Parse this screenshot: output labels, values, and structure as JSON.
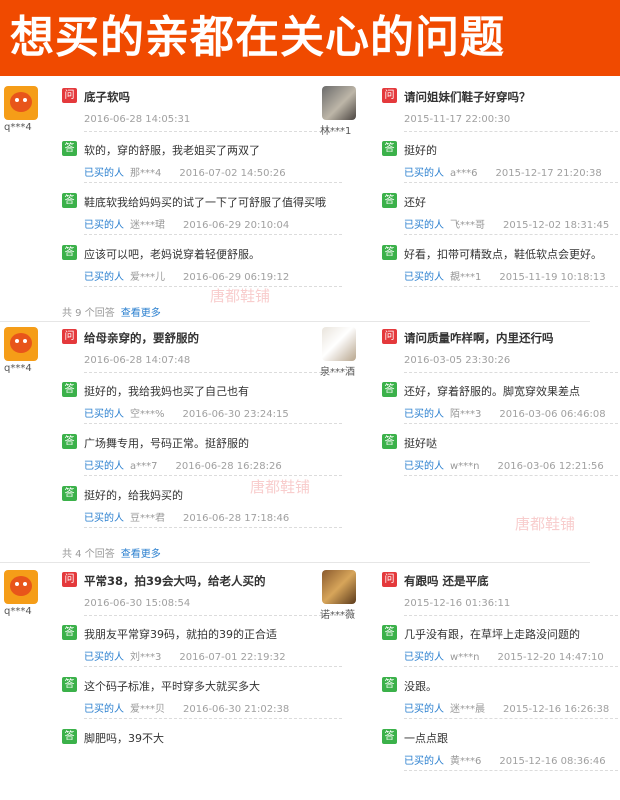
{
  "banner": {
    "title": "想买的亲都在关心的问题"
  },
  "footer_more": "查看更多",
  "buyer_label": "已买的人",
  "watermark": "唐都鞋铺",
  "colors": {
    "banner": "#f04a00",
    "question_badge": "#e4393c",
    "answer_badge": "#3bb14a",
    "link": "#2a7fcf"
  },
  "badges": {
    "q": "问",
    "a": "答"
  },
  "blocks": [
    {
      "footer": "共 9 个回答",
      "left": {
        "avatar": "orange-mascot-icon",
        "user": "q***4",
        "question": "底子软吗",
        "qdate": "2016-06-28 14:05:31",
        "answers": [
          {
            "text": "软的，穿的舒服，我老姐买了两双了",
            "user": "那***4",
            "date": "2016-07-02 14:50:26"
          },
          {
            "text": "鞋底软我给妈妈买的试了一下了可舒服了值得买哦",
            "user": "迷***珺",
            "date": "2016-06-29 20:10:04"
          },
          {
            "text": "应该可以吧，老妈说穿着轻便舒服。",
            "user": "爱***儿",
            "date": "2016-06-29 06:19:12"
          }
        ]
      },
      "right": {
        "avatar": "photo-avatar",
        "user": "林***1",
        "question": "请问姐妹们鞋子好穿吗？",
        "qdate": "2015-11-17 22:00:30",
        "answers": [
          {
            "text": "挺好的",
            "user": "a***6",
            "date": "2015-12-17 21:20:38"
          },
          {
            "text": "还好",
            "user": "飞***哥",
            "date": "2015-12-02 18:31:45"
          },
          {
            "text": "好看，扣带可精致点，鞋低软点会更好。",
            "user": "覩***1",
            "date": "2015-11-19 10:18:13"
          }
        ]
      }
    },
    {
      "footer": "共 4 个回答",
      "left": {
        "avatar": "orange-mascot-icon",
        "user": "q***4",
        "question": "给母亲穿的，要舒服的",
        "qdate": "2016-06-28 14:07:48",
        "answers": [
          {
            "text": "挺好的，我给我妈也买了自己也有",
            "user": "空***%",
            "date": "2016-06-30 23:24:15"
          },
          {
            "text": "广场舞专用，号码正常。挺舒服的",
            "user": "a***7",
            "date": "2016-06-28 16:28:26"
          },
          {
            "text": "挺好的，给我妈买的",
            "user": "豆***君",
            "date": "2016-06-28 17:18:46"
          }
        ]
      },
      "right": {
        "avatar": "cat-photo-avatar",
        "user": "泉***酒",
        "question": "请问质量咋样啊，内里还行吗",
        "qdate": "2016-03-05 23:30:26",
        "answers": [
          {
            "text": "还好，穿着舒服的。脚宽穿效果差点",
            "user": "陌***3",
            "date": "2016-03-06 06:46:08"
          },
          {
            "text": "挺好哒",
            "user": "w***n",
            "date": "2016-03-06 12:21:56"
          }
        ]
      }
    },
    {
      "footer": "",
      "left": {
        "avatar": "orange-mascot-icon",
        "user": "q***4",
        "question": "平常38，拍39会大吗，给老人买的",
        "qdate": "2016-06-30 15:08:54",
        "answers": [
          {
            "text": "我朋友平常穿39码，就拍的39的正合适",
            "user": "刘***3",
            "date": "2016-07-01 22:19:32"
          },
          {
            "text": "这个码子标准，平时穿多大就买多大",
            "user": "爱***贝",
            "date": "2016-06-30 21:02:38"
          },
          {
            "text": "脚肥吗，39不大",
            "user": "",
            "date": ""
          }
        ]
      },
      "right": {
        "avatar": "food-photo-avatar",
        "user": "诺***薇",
        "question": "有跟吗 还是平底",
        "qdate": "2015-12-16 01:36:11",
        "answers": [
          {
            "text": "几乎没有跟，在草坪上走路没问题的",
            "user": "w***n",
            "date": "2015-12-20 14:47:10"
          },
          {
            "text": "没跟。",
            "user": "迷***晨",
            "date": "2015-12-16 16:26:38"
          },
          {
            "text": "一点点跟",
            "user": "黄***6",
            "date": "2015-12-16 08:36:46"
          }
        ]
      }
    }
  ]
}
